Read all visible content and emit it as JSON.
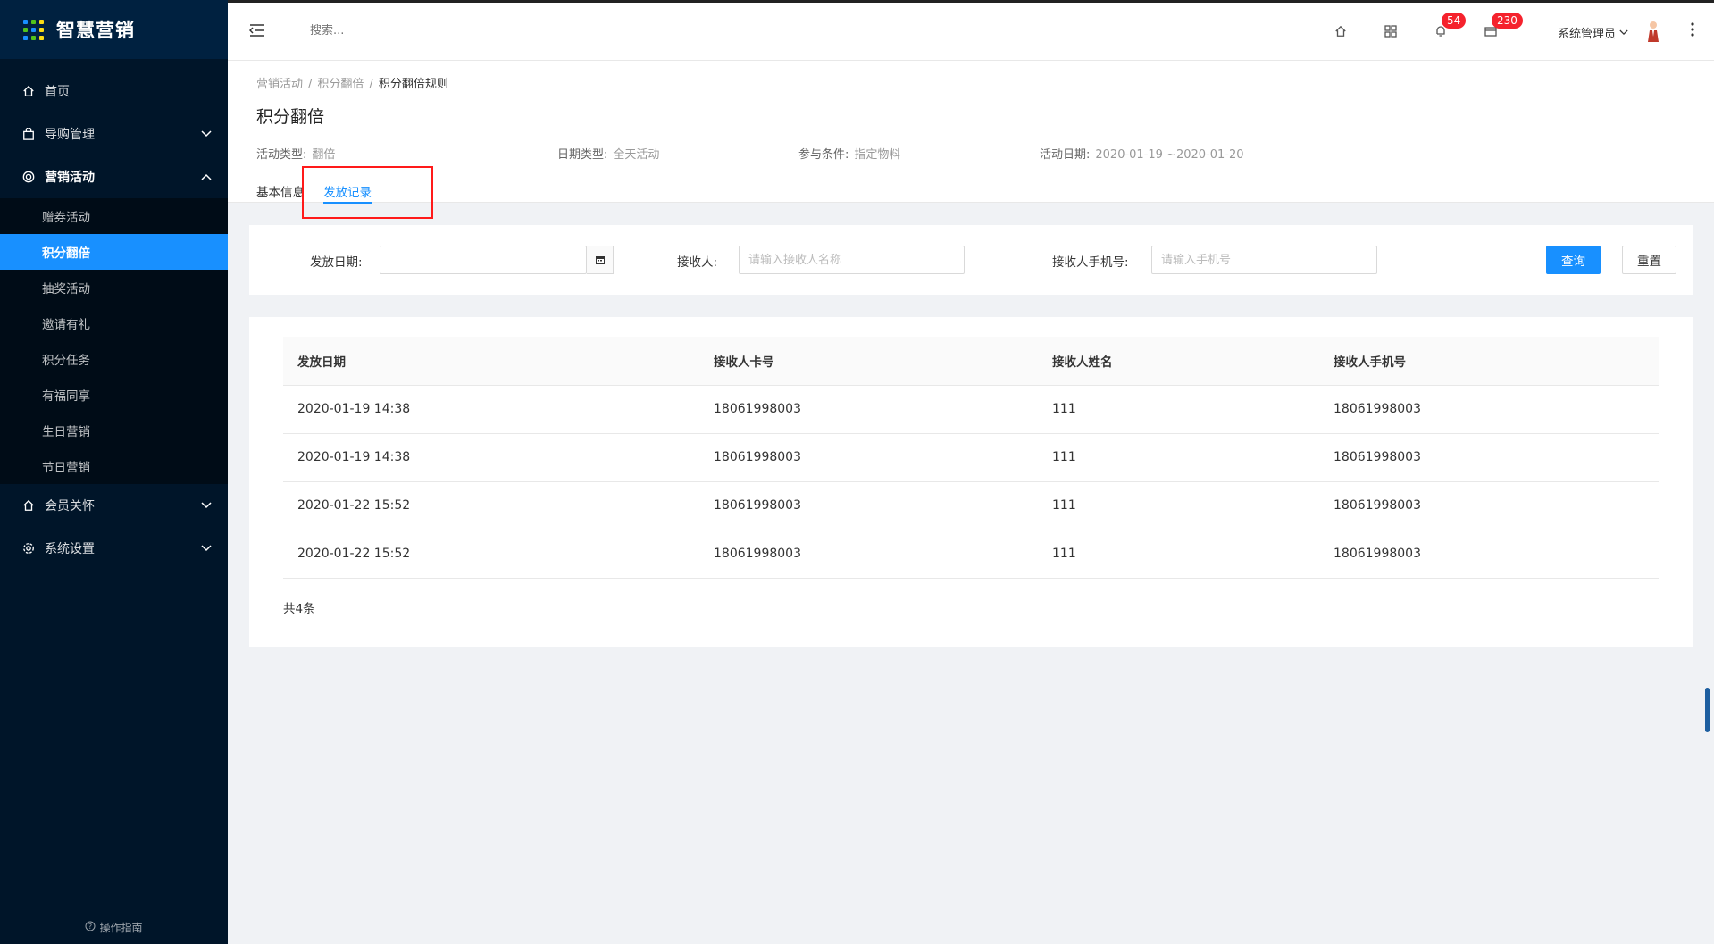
{
  "app": {
    "title": "智慧营销"
  },
  "sidebar": {
    "items": [
      {
        "label": "首页",
        "icon": "home-icon"
      },
      {
        "label": "导购管理",
        "icon": "bag-icon"
      },
      {
        "label": "营销活动",
        "icon": "target-icon"
      },
      {
        "label": "会员关怀",
        "icon": "home-icon"
      },
      {
        "label": "系统设置",
        "icon": "gear-icon"
      }
    ],
    "submenu": [
      {
        "label": "赠券活动"
      },
      {
        "label": "积分翻倍"
      },
      {
        "label": "抽奖活动"
      },
      {
        "label": "邀请有礼"
      },
      {
        "label": "积分任务"
      },
      {
        "label": "有福同享"
      },
      {
        "label": "生日营销"
      },
      {
        "label": "节日营销"
      }
    ],
    "guide": "操作指南"
  },
  "header": {
    "search_placeholder": "搜索...",
    "notify_count": "54",
    "message_count": "230",
    "user": "系统管理员"
  },
  "breadcrumb": [
    "营销活动",
    "积分翻倍",
    "积分翻倍规则"
  ],
  "page_title": "积分翻倍",
  "meta": {
    "type_label": "活动类型:",
    "type_value": "翻倍",
    "date_type_label": "日期类型:",
    "date_type_value": "全天活动",
    "cond_label": "参与条件:",
    "cond_value": "指定物料",
    "date_label": "活动日期:",
    "date_value": "2020-01-19 ~2020-01-20"
  },
  "tabs": [
    {
      "label": "基本信息"
    },
    {
      "label": "发放记录"
    }
  ],
  "filter": {
    "date_label": "发放日期:",
    "receiver_label": "接收人:",
    "receiver_placeholder": "请输入接收人名称",
    "phone_label": "接收人手机号:",
    "phone_placeholder": "请输入手机号",
    "query": "查询",
    "reset": "重置"
  },
  "table": {
    "columns": [
      "发放日期",
      "接收人卡号",
      "接收人姓名",
      "接收人手机号"
    ],
    "rows": [
      [
        "2020-01-19 14:38",
        "18061998003",
        "111",
        "18061998003"
      ],
      [
        "2020-01-19 14:38",
        "18061998003",
        "111",
        "18061998003"
      ],
      [
        "2020-01-22 15:52",
        "18061998003",
        "111",
        "18061998003"
      ],
      [
        "2020-01-22 15:52",
        "18061998003",
        "111",
        "18061998003"
      ]
    ],
    "total": "共4条"
  }
}
